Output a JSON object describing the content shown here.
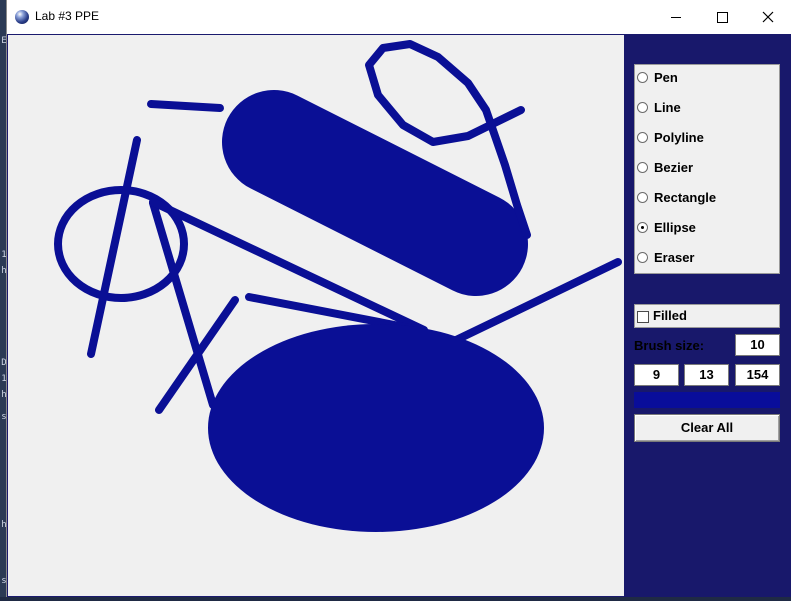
{
  "window": {
    "title": "Lab #3 PPE"
  },
  "side_strip": [
    "E",
    "1",
    "h",
    "D",
    "1",
    "h",
    "s",
    "h",
    "s"
  ],
  "tools": [
    {
      "label": "Pen",
      "checked": false
    },
    {
      "label": "Line",
      "checked": false
    },
    {
      "label": "Polyline",
      "checked": false
    },
    {
      "label": "Bezier",
      "checked": false
    },
    {
      "label": "Rectangle",
      "checked": false
    },
    {
      "label": "Ellipse",
      "checked": true
    },
    {
      "label": "Eraser",
      "checked": false
    }
  ],
  "filled": {
    "label": "Filled",
    "checked": false
  },
  "brush": {
    "label": "Brush size:",
    "size": "10"
  },
  "rgb": {
    "r": "9",
    "g": "13",
    "b": "154"
  },
  "colors": {
    "stroke": "#0a0f95",
    "canvas_bg": "#f0f0f0",
    "panel_bg": "#18186b"
  },
  "clear_button": "Clear All"
}
